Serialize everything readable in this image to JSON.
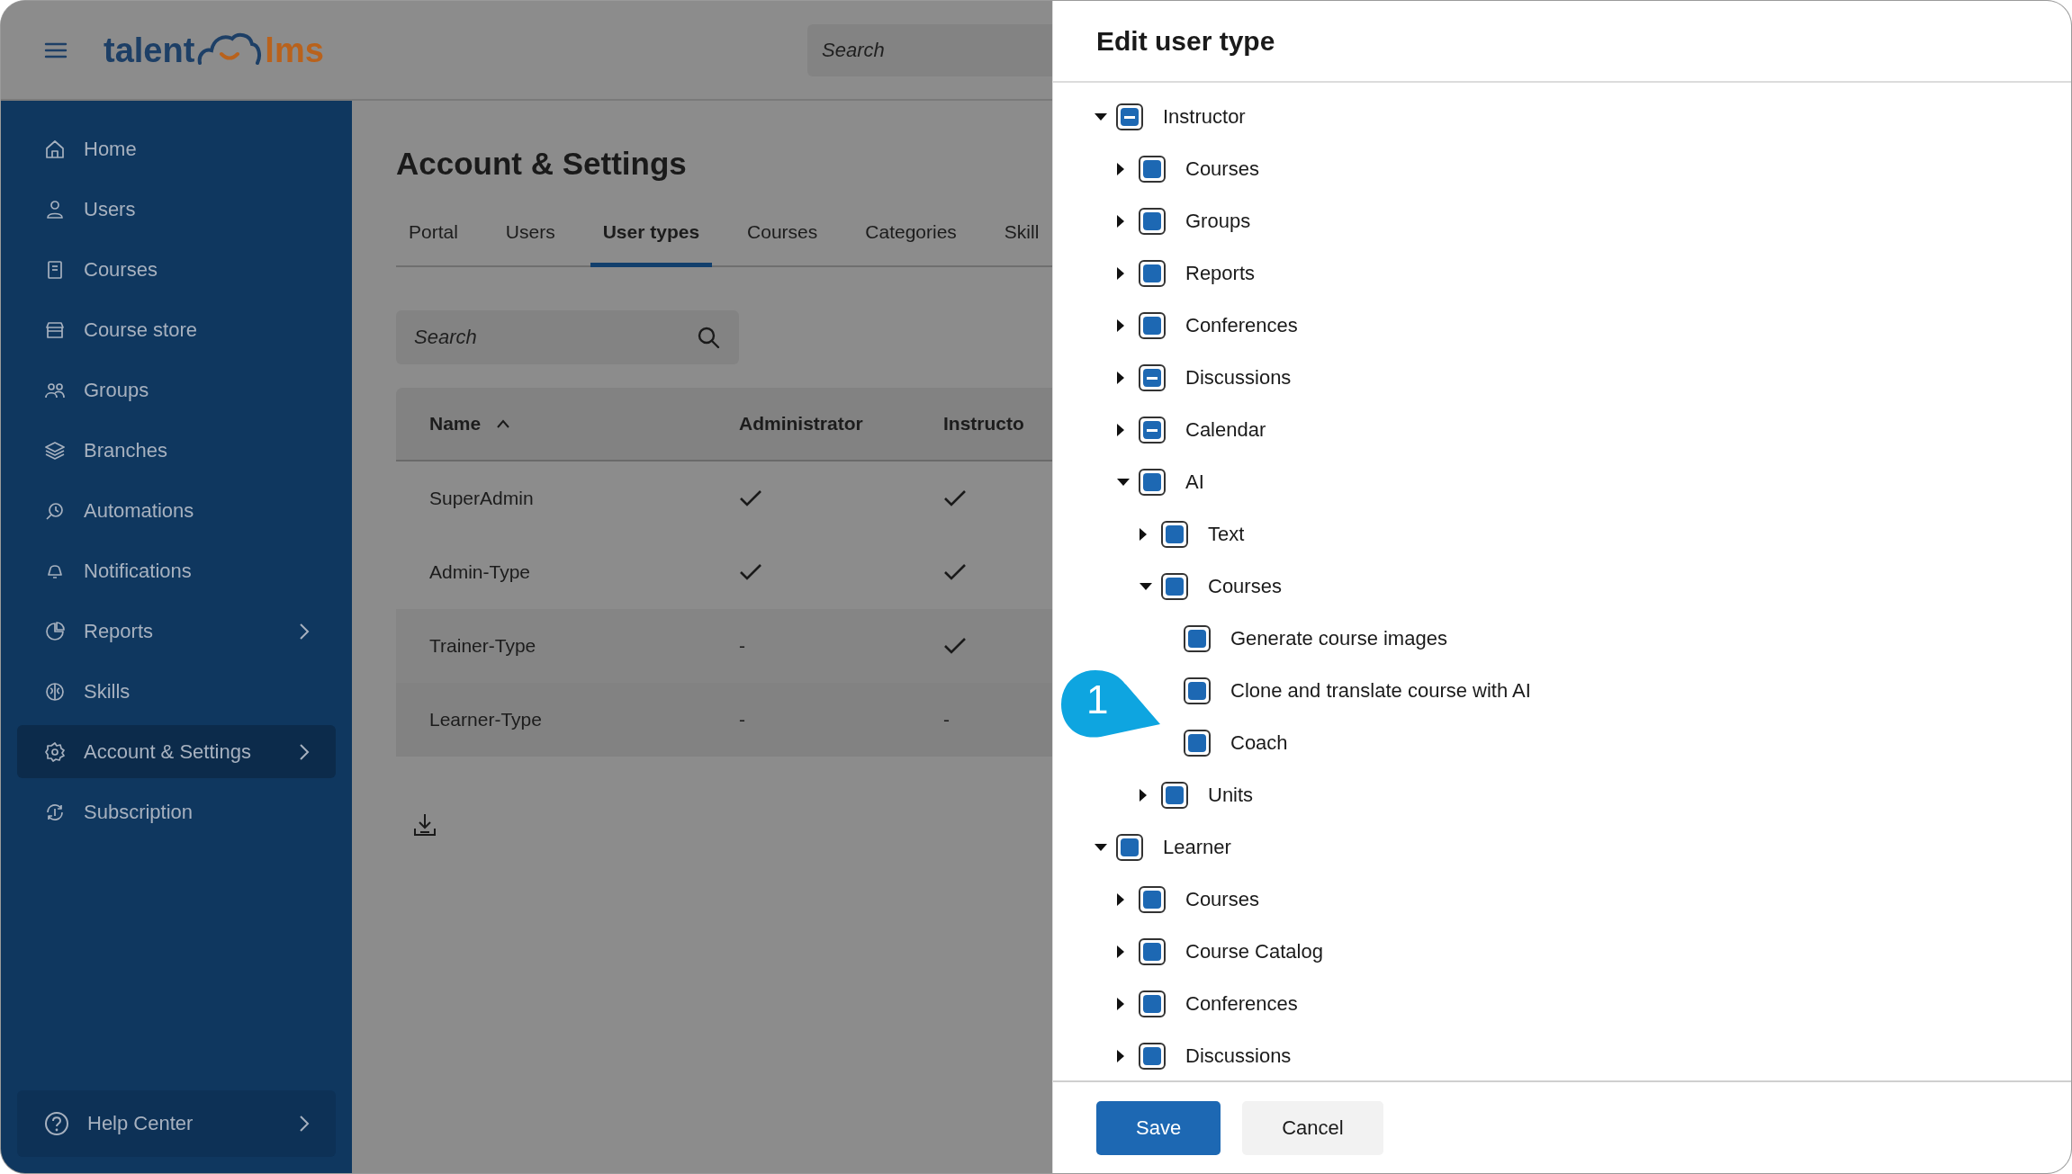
{
  "header": {
    "logo": {
      "left": "talent",
      "right": "lms"
    },
    "search": {
      "placeholder": "Search"
    }
  },
  "sidebar": {
    "items": [
      {
        "label": "Home",
        "selected": false,
        "submenu": false
      },
      {
        "label": "Users",
        "selected": false,
        "submenu": false
      },
      {
        "label": "Courses",
        "selected": false,
        "submenu": false
      },
      {
        "label": "Course store",
        "selected": false,
        "submenu": false
      },
      {
        "label": "Groups",
        "selected": false,
        "submenu": false
      },
      {
        "label": "Branches",
        "selected": false,
        "submenu": false
      },
      {
        "label": "Automations",
        "selected": false,
        "submenu": false
      },
      {
        "label": "Notifications",
        "selected": false,
        "submenu": false
      },
      {
        "label": "Reports",
        "selected": false,
        "submenu": true
      },
      {
        "label": "Skills",
        "selected": false,
        "submenu": false
      },
      {
        "label": "Account & Settings",
        "selected": true,
        "submenu": true
      },
      {
        "label": "Subscription",
        "selected": false,
        "submenu": false
      }
    ],
    "help": {
      "label": "Help Center"
    }
  },
  "page": {
    "title": "Account & Settings",
    "tabs": [
      {
        "label": "Portal",
        "selected": false
      },
      {
        "label": "Users",
        "selected": false
      },
      {
        "label": "User types",
        "selected": true
      },
      {
        "label": "Courses",
        "selected": false
      },
      {
        "label": "Categories",
        "selected": false
      },
      {
        "label": "Skill",
        "selected": false
      }
    ],
    "search": {
      "placeholder": "Search"
    },
    "table": {
      "columns": [
        {
          "label": "Name",
          "sorted": true
        },
        {
          "label": "Administrator",
          "sorted": false
        },
        {
          "label": "Instructo",
          "sorted": false
        }
      ],
      "rows": [
        {
          "cells": [
            {
              "kind": "text",
              "text": "SuperAdmin"
            },
            {
              "kind": "check"
            },
            {
              "kind": "check"
            }
          ]
        },
        {
          "cells": [
            {
              "kind": "text",
              "text": "Admin-Type"
            },
            {
              "kind": "check"
            },
            {
              "kind": "check"
            }
          ]
        },
        {
          "cells": [
            {
              "kind": "text",
              "text": "Trainer-Type"
            },
            {
              "kind": "text",
              "text": "-"
            },
            {
              "kind": "check"
            }
          ]
        },
        {
          "cells": [
            {
              "kind": "text",
              "text": "Learner-Type"
            },
            {
              "kind": "text",
              "text": "-"
            },
            {
              "kind": "text",
              "text": "-"
            }
          ]
        }
      ]
    }
  },
  "drawer": {
    "title": "Edit user type",
    "tree": [
      {
        "label": "Instructor",
        "checked": true,
        "partial": true,
        "expanded": true,
        "children": [
          {
            "label": "Courses",
            "checked": true,
            "partial": false,
            "expanded": false
          },
          {
            "label": "Groups",
            "checked": true,
            "partial": false,
            "expanded": false
          },
          {
            "label": "Reports",
            "checked": true,
            "partial": false,
            "expanded": false
          },
          {
            "label": "Conferences",
            "checked": true,
            "partial": false,
            "expanded": false
          },
          {
            "label": "Discussions",
            "checked": true,
            "partial": true,
            "expanded": false
          },
          {
            "label": "Calendar",
            "checked": true,
            "partial": true,
            "expanded": false
          },
          {
            "label": "AI",
            "checked": true,
            "partial": false,
            "expanded": true,
            "children": [
              {
                "label": "Text",
                "checked": true,
                "partial": false,
                "expanded": false
              },
              {
                "label": "Courses",
                "checked": true,
                "partial": false,
                "expanded": true,
                "children": [
                  {
                    "label": "Generate course images",
                    "checked": true,
                    "partial": false
                  },
                  {
                    "label": "Clone and translate course with AI",
                    "checked": true,
                    "partial": false
                  },
                  {
                    "label": "Coach",
                    "checked": true,
                    "partial": false
                  }
                ]
              },
              {
                "label": "Units",
                "checked": true,
                "partial": false,
                "expanded": false
              }
            ]
          }
        ]
      },
      {
        "label": "Learner",
        "checked": true,
        "partial": false,
        "expanded": true,
        "children": [
          {
            "label": "Courses",
            "checked": true,
            "partial": false,
            "expanded": false
          },
          {
            "label": "Course Catalog",
            "checked": true,
            "partial": false,
            "expanded": false
          },
          {
            "label": "Conferences",
            "checked": true,
            "partial": false,
            "expanded": false
          },
          {
            "label": "Discussions",
            "checked": true,
            "partial": false,
            "expanded": false
          }
        ]
      }
    ],
    "buttons": [
      {
        "label": "Save",
        "kind": "primary"
      },
      {
        "label": "Cancel",
        "kind": "secondary"
      }
    ],
    "callout": {
      "label": "1"
    }
  }
}
